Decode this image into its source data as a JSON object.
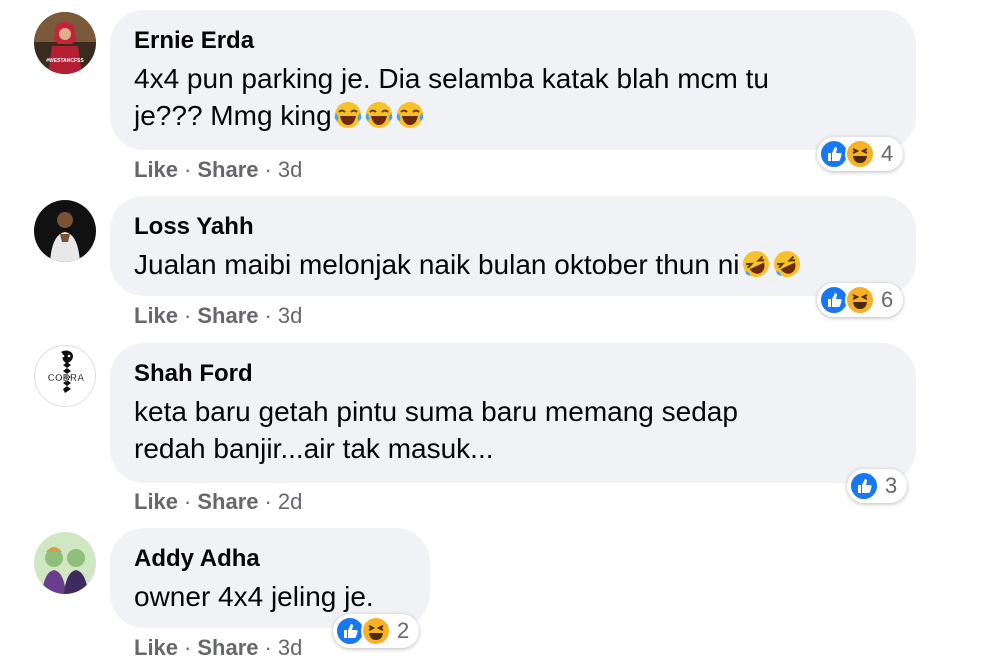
{
  "comments": [
    {
      "author": "Ernie Erda",
      "text": "4x4 pun parking je. Dia selamba katak blah mcm tu\nje??? Mmg king",
      "emoji_suffix": [
        "laughing-tears-emoji",
        "laughing-tears-emoji",
        "laughing-tears-emoji"
      ],
      "actions": {
        "like": "Like",
        "share": "Share",
        "time": "3d"
      },
      "reactions": {
        "icons": [
          "like-icon",
          "haha-icon"
        ],
        "count": "4"
      },
      "avatar": {
        "name": "avatar-ernie-erda",
        "badge_text": "#WESTANCFSS",
        "colors": [
          "#3a2b1f",
          "#c2243b"
        ]
      }
    },
    {
      "author": "Loss Yahh",
      "text": "Jualan maibi melonjak naik bulan oktober thun ni",
      "emoji_suffix": [
        "rolling-laughing-emoji",
        "rolling-laughing-emoji"
      ],
      "actions": {
        "like": "Like",
        "share": "Share",
        "time": "3d"
      },
      "reactions": {
        "icons": [
          "like-icon",
          "haha-icon"
        ],
        "count": "6"
      },
      "avatar": {
        "name": "avatar-loss-yahh",
        "colors": [
          "#1a1a1a",
          "#e8e8e8"
        ]
      }
    },
    {
      "author": "Shah Ford",
      "text": "keta baru getah pintu suma baru memang sedap\nredah banjir...air tak masuk...",
      "emoji_suffix": [],
      "actions": {
        "like": "Like",
        "share": "Share",
        "time": "2d"
      },
      "reactions": {
        "icons": [
          "like-icon"
        ],
        "count": "3"
      },
      "avatar": {
        "name": "avatar-shah-ford",
        "badge_text": "COBRA",
        "colors": [
          "#ffffff",
          "#111111"
        ]
      }
    },
    {
      "author": "Addy Adha",
      "text": "owner 4x4 jeling je.",
      "emoji_suffix": [],
      "actions": {
        "like": "Like",
        "share": "Share",
        "time": "3d"
      },
      "reactions": {
        "icons": [
          "like-icon",
          "haha-icon"
        ],
        "count": "2"
      },
      "avatar": {
        "name": "avatar-addy-adha",
        "colors": [
          "#8fbf7a",
          "#6a3d8f"
        ]
      }
    }
  ],
  "colors": {
    "bubble_bg": "#f0f2f5",
    "meta_text": "#65676b",
    "like_blue": "#1877f2",
    "haha_yellow": "#f7b125"
  }
}
